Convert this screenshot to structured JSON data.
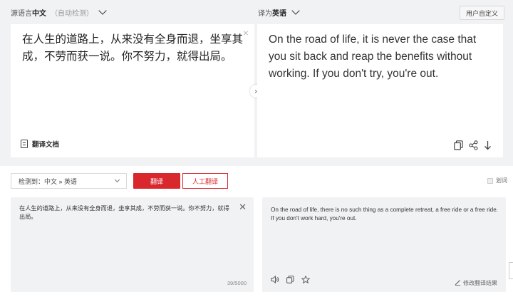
{
  "top": {
    "source_label": "源语言",
    "source_lang": "中文",
    "source_auto": "（自动检测）",
    "target_label": "译为",
    "target_lang": "英语",
    "custom_button": "用户自定义",
    "source_text": "在人生的道路上，从来没有全身而退，坐享其成，不劳而获一说。你不努力，就得出局。",
    "target_text": "On the road of life, it is never the case that you sit back and reap the benefits without working. If you don't try, you're out.",
    "doc_button": "翻译文档",
    "clear_symbol": "×",
    "swap_symbol": "›"
  },
  "bottom": {
    "detect_text": "检测到：中文 » 英语",
    "translate_button": "翻译",
    "human_button": "人工翻译",
    "segment_label": "划词",
    "source_text": "在人生的道路上，从来没有全身而退，坐享其成，不劳而获一说。你不努力，就得出局。",
    "target_text": "On the road of life, there is no such thing as a complete retreat, a free ride or a free ride. If you don't work hard, you're out.",
    "counter": "39/5000",
    "edit_link": "修改翻译结果",
    "clear_symbol": "✕"
  },
  "colors": {
    "accent": "#d9272e",
    "panel_bg": "#f1f2f4"
  },
  "icons": [
    "document-icon",
    "copy-icon",
    "share-icon",
    "download-icon",
    "speaker-icon",
    "star-icon",
    "pencil-icon",
    "chevron-down-icon",
    "close-icon"
  ]
}
